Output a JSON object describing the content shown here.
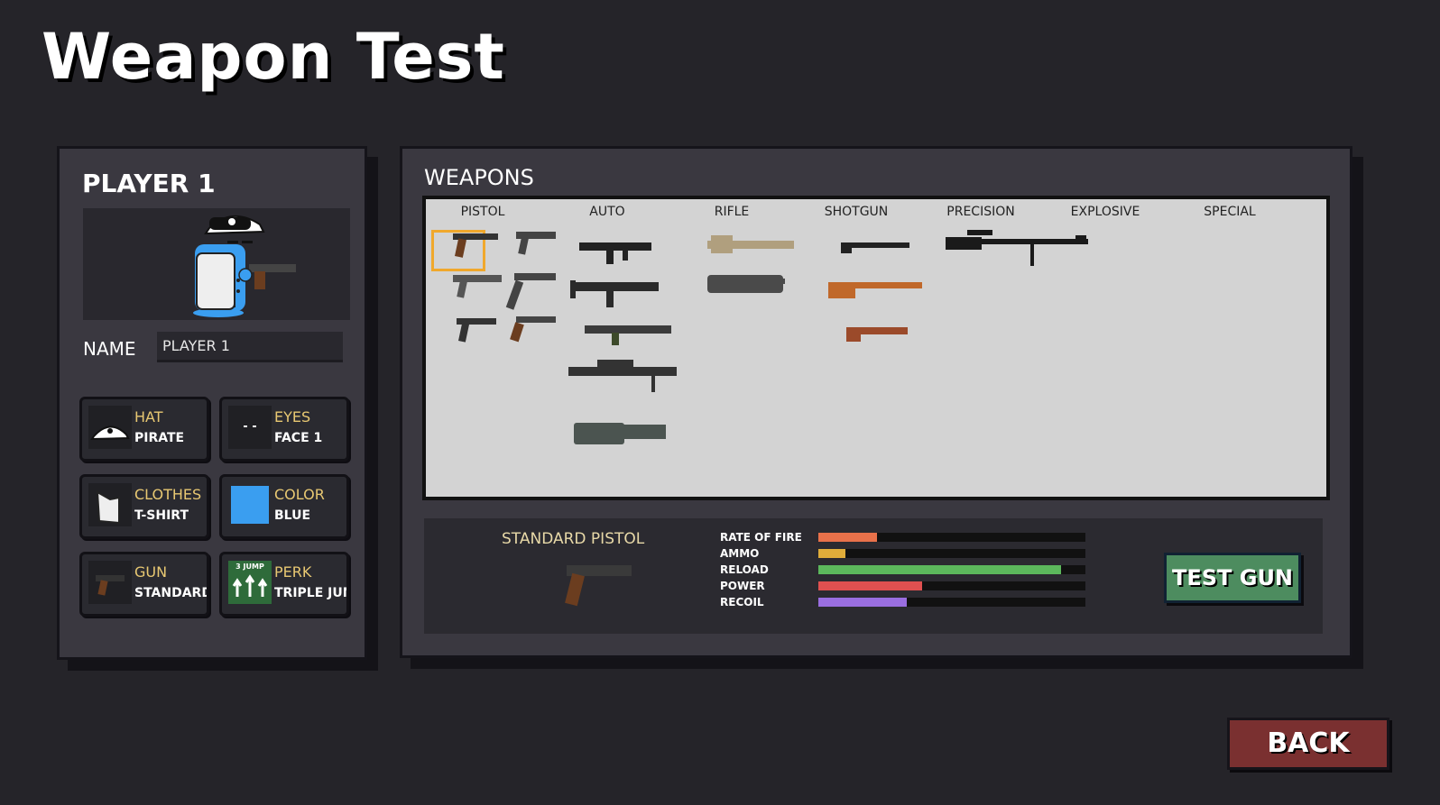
{
  "title": "Weapon Test",
  "player": {
    "heading": "PLAYER 1",
    "name_label": "NAME",
    "name_value": "PLAYER 1",
    "options": [
      {
        "category": "HAT",
        "value": "PIRATE",
        "icon": "pirate-hat-icon"
      },
      {
        "category": "EYES",
        "value": "FACE 1",
        "icon": "eyes-icon"
      },
      {
        "category": "CLOTHES",
        "value": "T-SHIRT",
        "icon": "tshirt-icon"
      },
      {
        "category": "COLOR",
        "value": "BLUE",
        "icon": "color-swatch-icon",
        "swatch": "#3a9ef0"
      },
      {
        "category": "GUN",
        "value": "STANDARD",
        "icon": "pistol-icon"
      },
      {
        "category": "PERK",
        "value": "TRIPLE JUMP",
        "icon": "triple-jump-icon",
        "badge": "3 JUMP"
      }
    ]
  },
  "weapons": {
    "heading": "WEAPONS",
    "columns": [
      "PISTOL",
      "AUTO",
      "RIFLE",
      "SHOTGUN",
      "PRECISION",
      "EXPLOSIVE",
      "SPECIAL"
    ],
    "selected": {
      "name": "STANDARD PISTOL",
      "stats": [
        {
          "label": "RATE OF FIRE",
          "value": 0.22,
          "color": "#e8714a"
        },
        {
          "label": "AMMO",
          "value": 0.1,
          "color": "#e0ad3a"
        },
        {
          "label": "RELOAD",
          "value": 0.91,
          "color": "#5cb85c"
        },
        {
          "label": "POWER",
          "value": 0.39,
          "color": "#e05050"
        },
        {
          "label": "RECOIL",
          "value": 0.33,
          "color": "#9a6ee0"
        }
      ]
    },
    "test_button": "TEST GUN"
  },
  "back_button": "BACK"
}
